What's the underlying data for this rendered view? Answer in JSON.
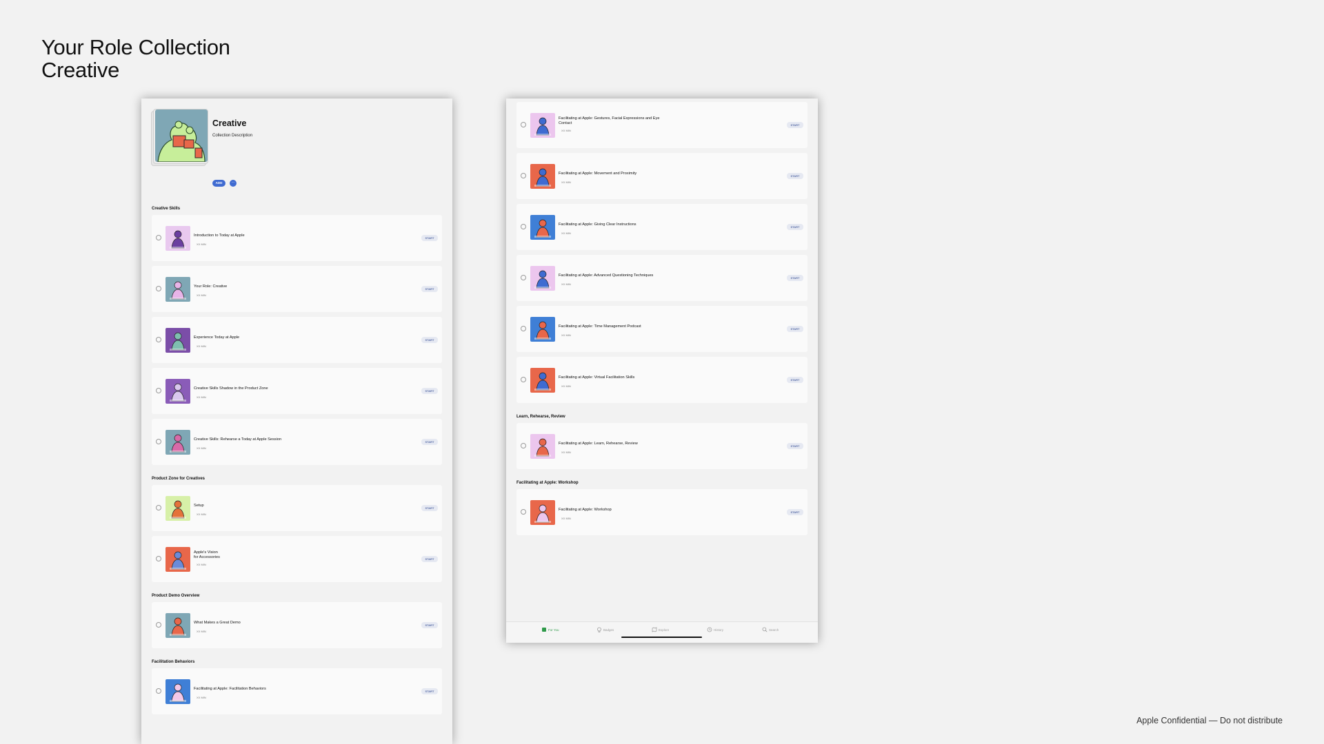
{
  "page": {
    "title_line1": "Your Role Collection",
    "title_line2": "Creative",
    "confidential": "Apple Confidential — Do not distribute"
  },
  "collection": {
    "title": "Creative",
    "description": "Collection Description",
    "add_label": "ADD",
    "more_label": "···"
  },
  "start_label": "START",
  "left_sections": [
    {
      "title": "Creative Skills",
      "items": [
        {
          "title": "Introduction to Today at Apple",
          "duration": "XX MIN",
          "thumb_bg": "#e9c9ef",
          "thumb_fg": "#6b3fa0"
        },
        {
          "title": "Your Role: Creative",
          "duration": "XX MIN",
          "thumb_bg": "#7fa7b5",
          "thumb_fg": "#e8b4e8"
        },
        {
          "title": "Experience Today at Apple",
          "duration": "XX MIN",
          "thumb_bg": "#7b4ea8",
          "thumb_fg": "#7fbfb0"
        },
        {
          "title": "Creative Skills Shadow in the Product Zone",
          "duration": "XX MIN",
          "thumb_bg": "#8a5cb8",
          "thumb_fg": "#d9c7ee"
        },
        {
          "title": "Creative Skills: Rehearse a Today at Apple Session",
          "duration": "XX MIN",
          "thumb_bg": "#7fa7b5",
          "thumb_fg": "#d86aa8"
        }
      ]
    },
    {
      "title": "Product Zone for Creatives",
      "items": [
        {
          "title": "Setup",
          "duration": "XX MIN",
          "thumb_bg": "#d7f0a8",
          "thumb_fg": "#e4733a"
        },
        {
          "title_line1": "Apple's Vision",
          "title_line2": "for Accessories",
          "duration": "XX MIN",
          "thumb_bg": "#e8674a",
          "thumb_fg": "#6a8bd8"
        }
      ]
    },
    {
      "title": "Product Demo Overview",
      "items": [
        {
          "title": "What Makes a Great Demo",
          "duration": "XX MIN",
          "thumb_bg": "#7fa7b5",
          "thumb_fg": "#e8674a"
        }
      ]
    },
    {
      "title": "Facilitation Behaviors",
      "items": [
        {
          "title": "Facilitating at Apple: Facilitation Behaviors",
          "duration": "XX MIN",
          "thumb_bg": "#3f7fd6",
          "thumb_fg": "#f2c8e8"
        }
      ]
    }
  ],
  "right_sections": [
    {
      "title": "",
      "items": [
        {
          "title_line1": "Facilitating at Apple: Gestures, Facial Expressions and Eye",
          "title_line2": "Contact",
          "duration": "XX MIN",
          "thumb_bg": "#ecc6ee",
          "thumb_fg": "#3f6bd1"
        },
        {
          "title": "Facilitating at Apple: Movement and Proximity",
          "duration": "XX MIN",
          "thumb_bg": "#e8674a",
          "thumb_fg": "#3f6bd1"
        },
        {
          "title": "Facilitating at Apple: Giving Clear Instructions",
          "duration": "XX MIN",
          "thumb_bg": "#3f7fd6",
          "thumb_fg": "#e8674a"
        },
        {
          "title": "Facilitating at Apple: Advanced Questioning Techniques",
          "duration": "XX MIN",
          "thumb_bg": "#ecc6ee",
          "thumb_fg": "#3f6bd1"
        },
        {
          "title": "Facilitating at Apple: Time Management Podcast",
          "duration": "XX MIN",
          "thumb_bg": "#3f7fd6",
          "thumb_fg": "#e8674a"
        },
        {
          "title": "Facilitating at Apple: Virtual Facilitation Skills",
          "duration": "XX MIN",
          "thumb_bg": "#e8674a",
          "thumb_fg": "#3f6bd1"
        }
      ]
    },
    {
      "title": "Learn, Rehearse, Review",
      "items": [
        {
          "title": "Facilitating at Apple: Learn, Rehearse, Review",
          "duration": "XX MIN",
          "thumb_bg": "#ecc6ee",
          "thumb_fg": "#e8674a"
        }
      ]
    },
    {
      "title": "Facilitating at Apple: Workshop",
      "items": [
        {
          "title": "Facilitating at Apple: Workshop",
          "duration": "XX MIN",
          "thumb_bg": "#e8674a",
          "thumb_fg": "#ecc6ee"
        }
      ]
    }
  ],
  "tabbar": {
    "tabs": [
      {
        "label": "For You",
        "icon": "for-you-icon",
        "active": true
      },
      {
        "label": "Badges",
        "icon": "badge-icon",
        "active": false
      },
      {
        "label": "Explore",
        "icon": "map-icon",
        "active": false
      },
      {
        "label": "History",
        "icon": "history-icon",
        "active": false
      },
      {
        "label": "Search",
        "icon": "search-icon",
        "active": false
      }
    ],
    "active_color": "#2f9a4a"
  }
}
